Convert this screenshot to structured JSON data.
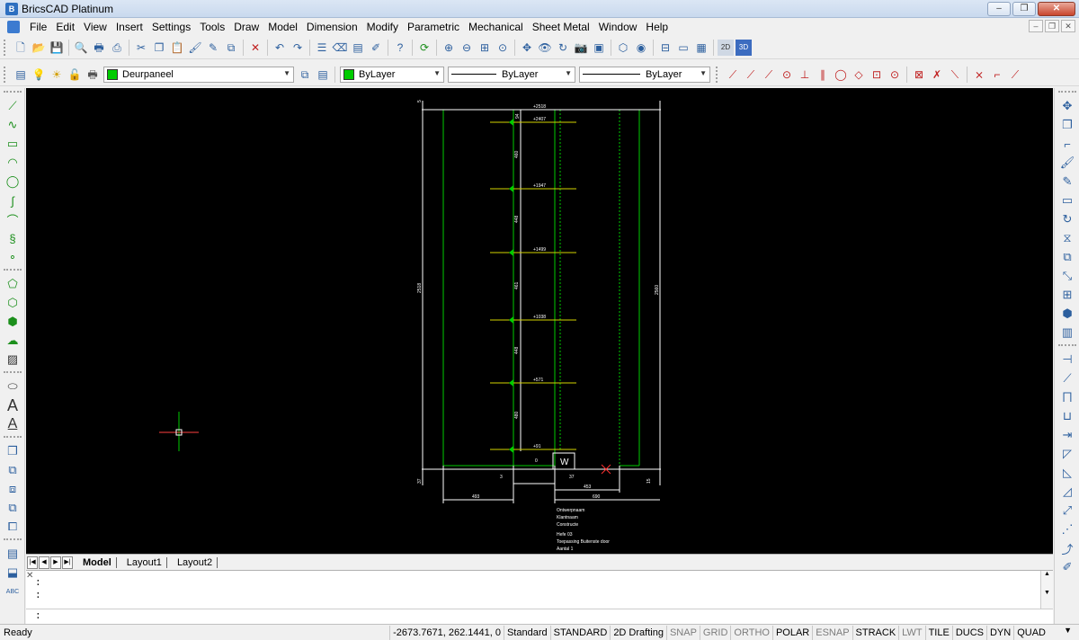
{
  "window": {
    "title": "BricsCAD Platinum",
    "minimize": "–",
    "restore": "❐",
    "close": "✕"
  },
  "menu": [
    "File",
    "Edit",
    "View",
    "Insert",
    "Settings",
    "Tools",
    "Draw",
    "Model",
    "Dimension",
    "Modify",
    "Parametric",
    "Mechanical",
    "Sheet Metal",
    "Window",
    "Help"
  ],
  "mdi": {
    "minimize": "–",
    "restore": "❐",
    "close": "✕"
  },
  "toolbar2": {
    "layer_name": "Deurpaneel",
    "layer_color": "#00cc00",
    "color_combo": "ByLayer",
    "color_swatch": "#00cc00",
    "linetype_combo": "ByLayer",
    "lineweight_combo": "ByLayer"
  },
  "toolbar1_icons": [
    "new-icon",
    "open-icon",
    "save-icon",
    "print-preview-icon",
    "print-icon",
    "plot-icon",
    "cut-icon",
    "copy-icon",
    "paste-icon",
    "match-properties-icon",
    "pick-icon",
    "block-icon",
    "delete-icon",
    "undo-icon",
    "redo-icon",
    "properties-icon",
    "erase-icon",
    "layers-icon",
    "edit-icon",
    "help-icon",
    "regen-icon",
    "zoom-in-icon",
    "zoom-out-icon",
    "zoom-window-icon",
    "zoom-extents-icon",
    "pan-icon",
    "view-icon",
    "orbit-icon",
    "camera-icon",
    "render-icon",
    "3d-box-icon",
    "sphere-icon",
    "tiled-view-icon",
    "layout-icon",
    "viewport-icon"
  ],
  "labels_2d3d": {
    "two_d": "2D",
    "three_d": "3D"
  },
  "drawing": {
    "top_labels": [
      "+2518",
      "+2407",
      "+1947",
      "+1499",
      "+1038",
      "+571",
      "+91"
    ],
    "spacing_labels": [
      "460",
      "448",
      "461",
      "448",
      "480"
    ],
    "dim_left_height": "2518",
    "dim_right_height": "2560",
    "dim_bottom_left": "493",
    "dim_bottom_3": "3",
    "dim_bottom_37": "37",
    "dim_bottom_453": "453",
    "dim_bottom_690": "690",
    "dim_left_37": "37",
    "dim_right_15": "15",
    "dim_top_5": "5",
    "dim_top_94": "94",
    "zero_label": "0",
    "notes": [
      "Ontwerpnaam",
      "Klantnaam",
      "Constructe",
      "",
      "Hefe 03",
      "Toepassing Buitenste door",
      "Aantal 1"
    ]
  },
  "tabs": [
    "Model",
    "Layout1",
    "Layout2"
  ],
  "command_lines": [
    ":",
    ":",
    ":"
  ],
  "status": {
    "ready": "Ready",
    "coords": "-2673.7671, 262.1441, 0",
    "items": [
      {
        "label": "Standard",
        "on": true
      },
      {
        "label": "STANDARD",
        "on": true
      },
      {
        "label": "2D Drafting",
        "on": true
      },
      {
        "label": "SNAP",
        "on": false
      },
      {
        "label": "GRID",
        "on": false
      },
      {
        "label": "ORTHO",
        "on": false
      },
      {
        "label": "POLAR",
        "on": true
      },
      {
        "label": "ESNAP",
        "on": false
      },
      {
        "label": "STRACK",
        "on": true
      },
      {
        "label": "LWT",
        "on": false
      },
      {
        "label": "TILE",
        "on": true
      },
      {
        "label": "DUCS",
        "on": true
      },
      {
        "label": "DYN",
        "on": true
      },
      {
        "label": "QUAD",
        "on": true
      }
    ]
  }
}
